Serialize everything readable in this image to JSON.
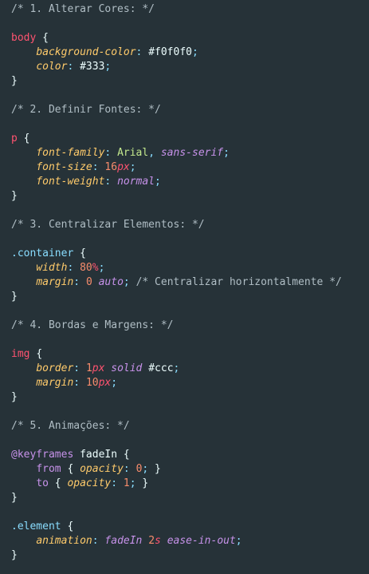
{
  "colors": {
    "background": "#263238",
    "comment": "#b0bec5",
    "selector": "#ff5370",
    "property": "#ffcb6b",
    "string": "#c3e88d",
    "value_keyword": "#c792ea",
    "number": "#f78c6c",
    "punctuation": "#89ddff",
    "text": "#eeffff"
  },
  "code": {
    "lines": [
      [
        {
          "t": "comment",
          "v": "/* 1. Alterar Cores: */"
        }
      ],
      [],
      [
        {
          "t": "selector",
          "v": "body"
        },
        {
          "t": "plain",
          "v": " "
        },
        {
          "t": "brace",
          "v": "{"
        }
      ],
      [
        {
          "t": "plain",
          "v": "    "
        },
        {
          "t": "prop",
          "v": "background-color"
        },
        {
          "t": "punct",
          "v": ":"
        },
        {
          "t": "plain",
          "v": " "
        },
        {
          "t": "hex",
          "v": "#f0f0f0"
        },
        {
          "t": "punct",
          "v": ";"
        }
      ],
      [
        {
          "t": "plain",
          "v": "    "
        },
        {
          "t": "prop",
          "v": "color"
        },
        {
          "t": "punct",
          "v": ":"
        },
        {
          "t": "plain",
          "v": " "
        },
        {
          "t": "hex",
          "v": "#333"
        },
        {
          "t": "punct",
          "v": ";"
        }
      ],
      [
        {
          "t": "brace",
          "v": "}"
        }
      ],
      [],
      [
        {
          "t": "comment",
          "v": "/* 2. Definir Fontes: */"
        }
      ],
      [],
      [
        {
          "t": "selector",
          "v": "p"
        },
        {
          "t": "plain",
          "v": " "
        },
        {
          "t": "brace",
          "v": "{"
        }
      ],
      [
        {
          "t": "plain",
          "v": "    "
        },
        {
          "t": "prop",
          "v": "font-family"
        },
        {
          "t": "punct",
          "v": ":"
        },
        {
          "t": "plain",
          "v": " "
        },
        {
          "t": "string",
          "v": "Arial"
        },
        {
          "t": "punct",
          "v": ","
        },
        {
          "t": "plain",
          "v": " "
        },
        {
          "t": "value",
          "v": "sans-serif"
        },
        {
          "t": "punct",
          "v": ";"
        }
      ],
      [
        {
          "t": "plain",
          "v": "    "
        },
        {
          "t": "prop",
          "v": "font-size"
        },
        {
          "t": "punct",
          "v": ":"
        },
        {
          "t": "plain",
          "v": " "
        },
        {
          "t": "number",
          "v": "16"
        },
        {
          "t": "unit",
          "v": "px"
        },
        {
          "t": "punct",
          "v": ";"
        }
      ],
      [
        {
          "t": "plain",
          "v": "    "
        },
        {
          "t": "prop",
          "v": "font-weight"
        },
        {
          "t": "punct",
          "v": ":"
        },
        {
          "t": "plain",
          "v": " "
        },
        {
          "t": "value",
          "v": "normal"
        },
        {
          "t": "punct",
          "v": ";"
        }
      ],
      [
        {
          "t": "brace",
          "v": "}"
        }
      ],
      [],
      [
        {
          "t": "comment",
          "v": "/* 3. Centralizar Elementos: */"
        }
      ],
      [],
      [
        {
          "t": "class",
          "v": ".container"
        },
        {
          "t": "plain",
          "v": " "
        },
        {
          "t": "brace",
          "v": "{"
        }
      ],
      [
        {
          "t": "plain",
          "v": "    "
        },
        {
          "t": "prop",
          "v": "width"
        },
        {
          "t": "punct",
          "v": ":"
        },
        {
          "t": "plain",
          "v": " "
        },
        {
          "t": "number",
          "v": "80"
        },
        {
          "t": "unit",
          "v": "%"
        },
        {
          "t": "punct",
          "v": ";"
        }
      ],
      [
        {
          "t": "plain",
          "v": "    "
        },
        {
          "t": "prop",
          "v": "margin"
        },
        {
          "t": "punct",
          "v": ":"
        },
        {
          "t": "plain",
          "v": " "
        },
        {
          "t": "number",
          "v": "0"
        },
        {
          "t": "plain",
          "v": " "
        },
        {
          "t": "value",
          "v": "auto"
        },
        {
          "t": "punct",
          "v": ";"
        },
        {
          "t": "plain",
          "v": " "
        },
        {
          "t": "comment",
          "v": "/* Centralizar horizontalmente */"
        }
      ],
      [
        {
          "t": "brace",
          "v": "}"
        }
      ],
      [],
      [
        {
          "t": "comment",
          "v": "/* 4. Bordas e Margens: */"
        }
      ],
      [],
      [
        {
          "t": "selector",
          "v": "img"
        },
        {
          "t": "plain",
          "v": " "
        },
        {
          "t": "brace",
          "v": "{"
        }
      ],
      [
        {
          "t": "plain",
          "v": "    "
        },
        {
          "t": "prop",
          "v": "border"
        },
        {
          "t": "punct",
          "v": ":"
        },
        {
          "t": "plain",
          "v": " "
        },
        {
          "t": "number",
          "v": "1"
        },
        {
          "t": "unit",
          "v": "px"
        },
        {
          "t": "plain",
          "v": " "
        },
        {
          "t": "value",
          "v": "solid"
        },
        {
          "t": "plain",
          "v": " "
        },
        {
          "t": "hex",
          "v": "#ccc"
        },
        {
          "t": "punct",
          "v": ";"
        }
      ],
      [
        {
          "t": "plain",
          "v": "    "
        },
        {
          "t": "prop",
          "v": "margin"
        },
        {
          "t": "punct",
          "v": ":"
        },
        {
          "t": "plain",
          "v": " "
        },
        {
          "t": "number",
          "v": "10"
        },
        {
          "t": "unit",
          "v": "px"
        },
        {
          "t": "punct",
          "v": ";"
        }
      ],
      [
        {
          "t": "brace",
          "v": "}"
        }
      ],
      [],
      [
        {
          "t": "comment",
          "v": "/* 5. Animações: */"
        }
      ],
      [],
      [
        {
          "t": "at",
          "v": "@keyframes"
        },
        {
          "t": "plain",
          "v": " fadeIn "
        },
        {
          "t": "brace",
          "v": "{"
        }
      ],
      [
        {
          "t": "plain",
          "v": "    "
        },
        {
          "t": "keyword",
          "v": "from"
        },
        {
          "t": "plain",
          "v": " "
        },
        {
          "t": "brace",
          "v": "{"
        },
        {
          "t": "plain",
          "v": " "
        },
        {
          "t": "prop",
          "v": "opacity"
        },
        {
          "t": "punct",
          "v": ":"
        },
        {
          "t": "plain",
          "v": " "
        },
        {
          "t": "number",
          "v": "0"
        },
        {
          "t": "punct",
          "v": ";"
        },
        {
          "t": "plain",
          "v": " "
        },
        {
          "t": "brace",
          "v": "}"
        }
      ],
      [
        {
          "t": "plain",
          "v": "    "
        },
        {
          "t": "keyword",
          "v": "to"
        },
        {
          "t": "plain",
          "v": " "
        },
        {
          "t": "brace",
          "v": "{"
        },
        {
          "t": "plain",
          "v": " "
        },
        {
          "t": "prop",
          "v": "opacity"
        },
        {
          "t": "punct",
          "v": ":"
        },
        {
          "t": "plain",
          "v": " "
        },
        {
          "t": "number",
          "v": "1"
        },
        {
          "t": "punct",
          "v": ";"
        },
        {
          "t": "plain",
          "v": " "
        },
        {
          "t": "brace",
          "v": "}"
        }
      ],
      [
        {
          "t": "brace",
          "v": "}"
        }
      ],
      [],
      [
        {
          "t": "class",
          "v": ".element"
        },
        {
          "t": "plain",
          "v": " "
        },
        {
          "t": "brace",
          "v": "{"
        }
      ],
      [
        {
          "t": "plain",
          "v": "    "
        },
        {
          "t": "prop",
          "v": "animation"
        },
        {
          "t": "punct",
          "v": ":"
        },
        {
          "t": "plain",
          "v": " "
        },
        {
          "t": "value",
          "v": "fadeIn"
        },
        {
          "t": "plain",
          "v": " "
        },
        {
          "t": "number",
          "v": "2"
        },
        {
          "t": "unit",
          "v": "s"
        },
        {
          "t": "plain",
          "v": " "
        },
        {
          "t": "value",
          "v": "ease-in-out"
        },
        {
          "t": "punct",
          "v": ";"
        }
      ],
      [
        {
          "t": "brace",
          "v": "}"
        }
      ]
    ]
  }
}
